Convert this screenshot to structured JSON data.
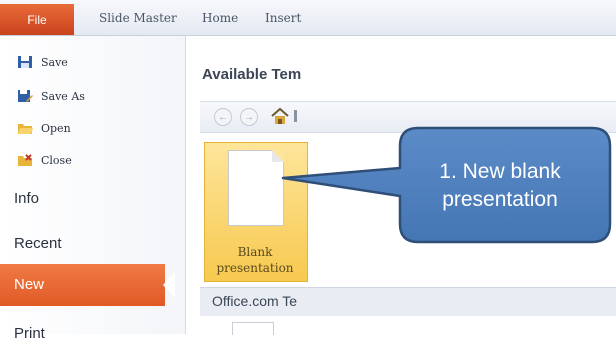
{
  "ribbon": {
    "file_tab": "File",
    "tabs": [
      "Slide Master",
      "Home",
      "Insert"
    ]
  },
  "sidebar": {
    "commands": [
      {
        "label": "Save",
        "icon": "save-icon"
      },
      {
        "label": "Save As",
        "icon": "save-as-icon"
      },
      {
        "label": "Open",
        "icon": "open-folder-icon"
      },
      {
        "label": "Close",
        "icon": "close-file-icon"
      }
    ],
    "sections": [
      "Info",
      "Recent"
    ],
    "active_section": "New",
    "next_section": "Print"
  },
  "main": {
    "title": "Available Tem",
    "template_label": "Blank presentation",
    "office_section": "Office.com Te"
  },
  "callout": {
    "text": "1. New blank presentation"
  },
  "colors": {
    "file_tab": "#d9542a",
    "new_highlight": "#e8683a",
    "template_card": "#fbd66f",
    "callout_fill": "#4f81bd",
    "callout_border": "#2f4e78"
  }
}
